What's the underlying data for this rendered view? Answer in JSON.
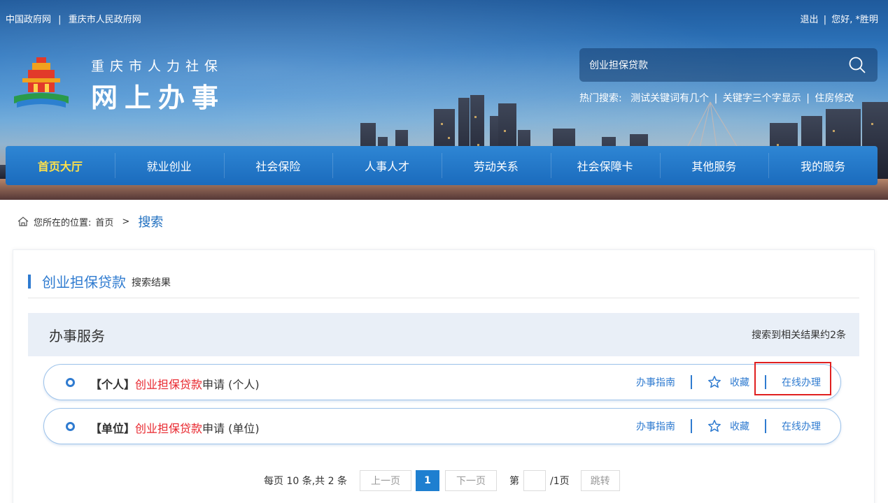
{
  "top_links": {
    "gov": "中国政府网",
    "sep": "|",
    "cq_gov": "重庆市人民政府网",
    "logout": "退出",
    "greeting": "您好, *胜明"
  },
  "logo": {
    "subtitle": "重庆市人力社保",
    "title": "网上办事"
  },
  "search": {
    "value": "创业担保贷款",
    "hot_label": "热门搜索:",
    "hot_items": [
      "测试关键词有几个",
      "关键字三个字显示",
      "住房修改"
    ]
  },
  "nav": {
    "items": [
      "首页大厅",
      "就业创业",
      "社会保险",
      "人事人才",
      "劳动关系",
      "社会保障卡",
      "其他服务",
      "我的服务"
    ],
    "active": 0
  },
  "breadcrumb": {
    "label": "您所在的位置:",
    "home": "首页",
    "arrow": ">",
    "current": "搜索"
  },
  "results": {
    "keyword": "创业担保贷款",
    "suffix": "搜索结果",
    "section_name": "办事服务",
    "count_text": "搜索到相关结果约2条",
    "rows": [
      {
        "tag": "【个人】",
        "keyword": "创业担保贷款",
        "rest": "申请 (个人)",
        "guide": "办事指南",
        "fav": "收藏",
        "online": "在线办理"
      },
      {
        "tag": "【单位】",
        "keyword": "创业担保贷款",
        "rest": "申请 (单位)",
        "guide": "办事指南",
        "fav": "收藏",
        "online": "在线办理"
      }
    ]
  },
  "pagination": {
    "summary": "每页 10 条,共 2 条",
    "prev": "上一页",
    "current_page": "1",
    "next": "下一页",
    "go_label": "第",
    "total_pages": "/1页",
    "jump": "跳转"
  },
  "colors": {
    "nav_active": "#ffe14a",
    "accent": "#2f7bd0",
    "keyword_red": "#e8262d",
    "highlight": "#e02020"
  }
}
